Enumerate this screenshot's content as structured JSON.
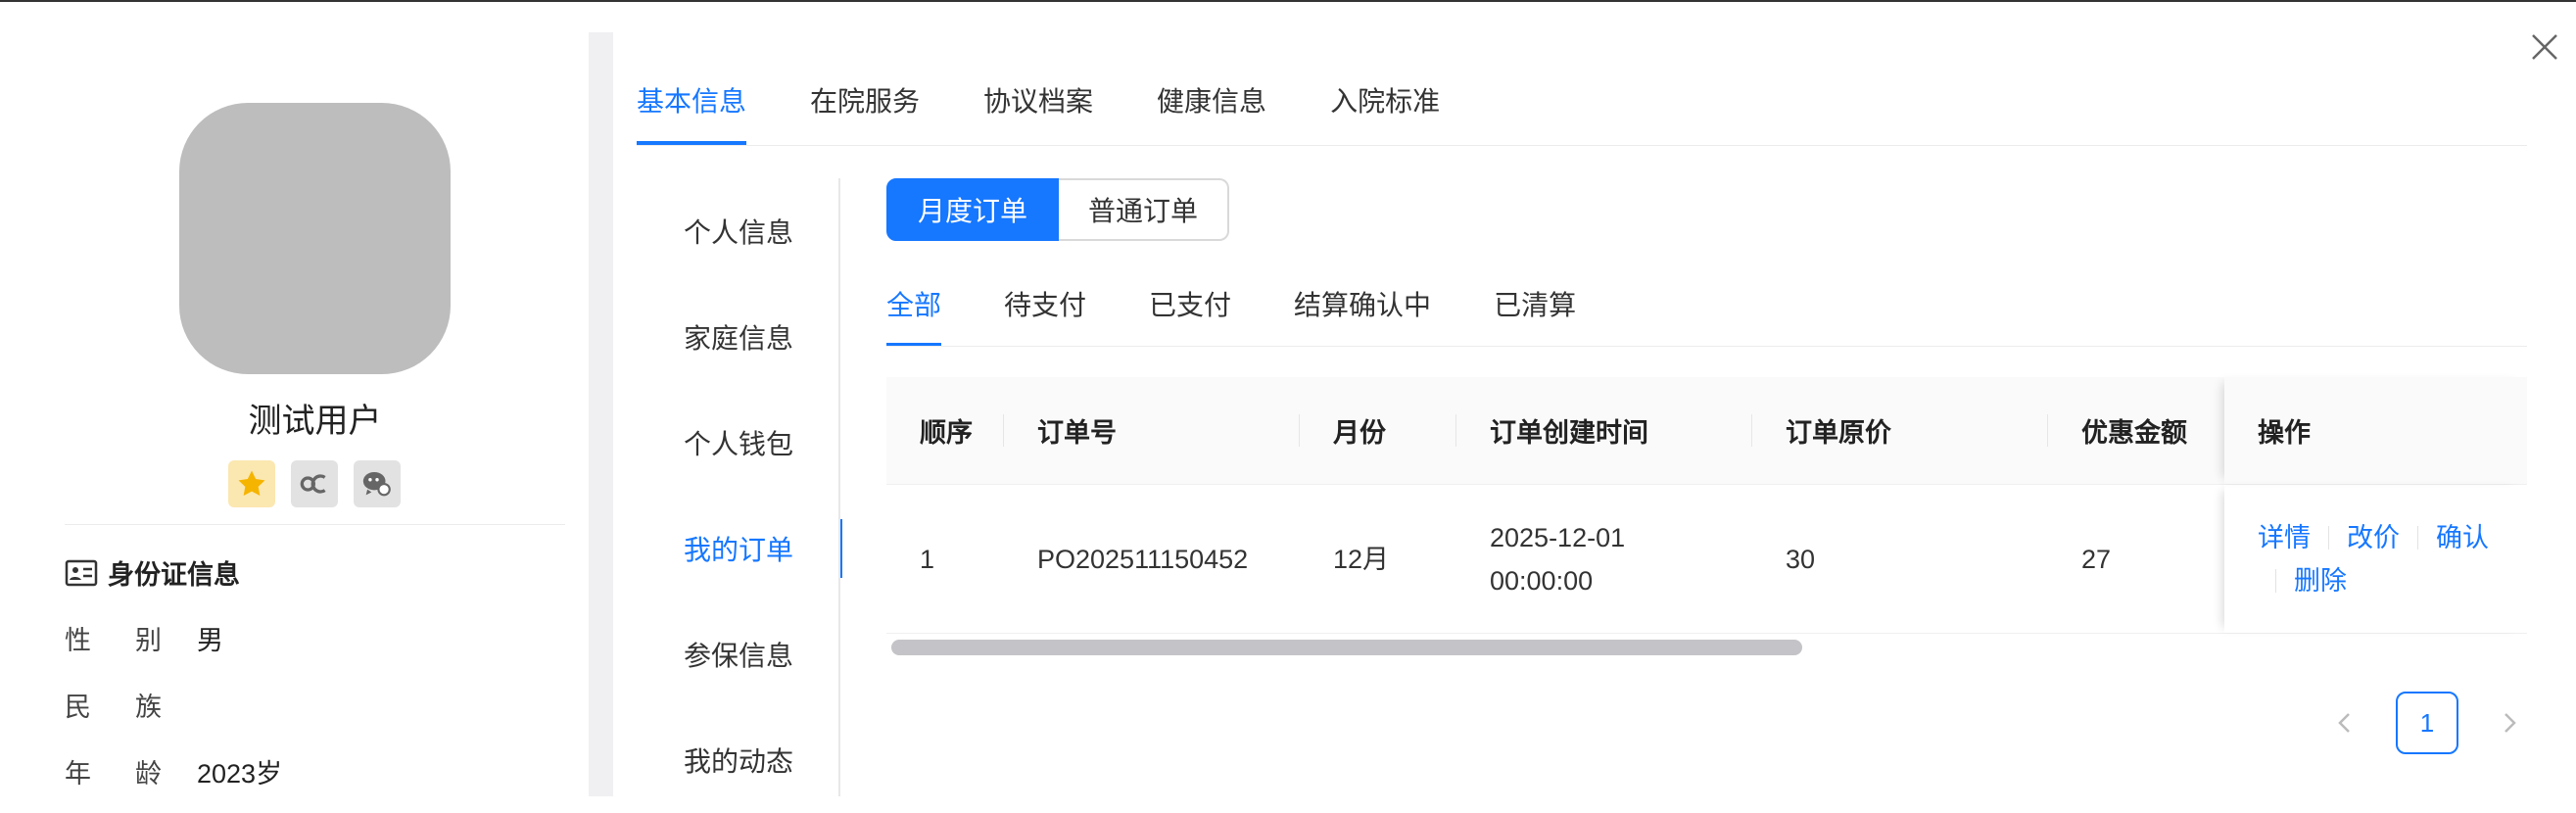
{
  "profile": {
    "name": "测试用户",
    "badges": [
      "star-icon",
      "link-icon",
      "wechat-icon"
    ],
    "idcard_title": "身份证信息",
    "fields": [
      {
        "k1": "性",
        "k2": "别",
        "value": "男"
      },
      {
        "k1": "民",
        "k2": "族",
        "value": ""
      },
      {
        "k1": "年",
        "k2": "龄",
        "value": "2023岁"
      }
    ]
  },
  "top_tabs": [
    "基本信息",
    "在院服务",
    "协议档案",
    "健康信息",
    "入院标准"
  ],
  "side_menu": [
    "个人信息",
    "家庭信息",
    "个人钱包",
    "我的订单",
    "参保信息",
    "我的动态"
  ],
  "order_type": [
    "月度订单",
    "普通订单"
  ],
  "status_tabs": [
    "全部",
    "待支付",
    "已支付",
    "结算确认中",
    "已清算"
  ],
  "table": {
    "columns": [
      "顺序",
      "订单号",
      "月份",
      "订单创建时间",
      "订单原价",
      "优惠金额",
      "操作"
    ],
    "rows": [
      {
        "index": "1",
        "order_no": "PO202511150452",
        "month": "12月",
        "created_date": "2025-12-01",
        "created_time": "00:00:00",
        "original_price": "30",
        "discount": "27",
        "actions": [
          "详情",
          "改价",
          "确认",
          "删除"
        ]
      }
    ]
  },
  "pagination": {
    "current": "1"
  },
  "colors": {
    "accent": "#1677ff",
    "avatar": "#bdbdbd"
  }
}
